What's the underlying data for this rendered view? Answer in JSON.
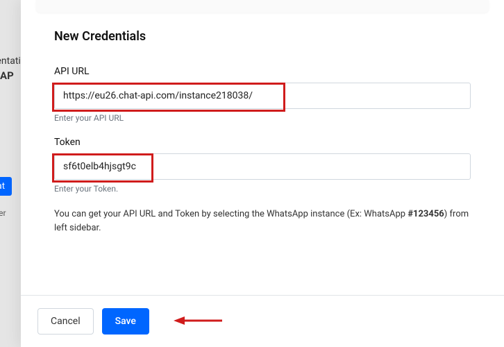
{
  "background": {
    "line1": "Documentation : Do",
    "line2": "AP",
    "chip": "Chat",
    "line3": "partner"
  },
  "modal": {
    "title": "New Credentials",
    "fields": {
      "api_url": {
        "label": "API URL",
        "value": "https://eu26.chat-api.com/instance218038/",
        "hint": "Enter your API URL"
      },
      "token": {
        "label": "Token",
        "value": "sf6t0elb4hjsgt9c",
        "hint": "Enter your Token."
      }
    },
    "info_prefix": "You can get your API URL and Token by selecting the WhatsApp instance (Ex: WhatsApp ",
    "info_bold": "#123456",
    "info_suffix": ") from left sidebar.",
    "footer": {
      "cancel": "Cancel",
      "save": "Save"
    }
  }
}
